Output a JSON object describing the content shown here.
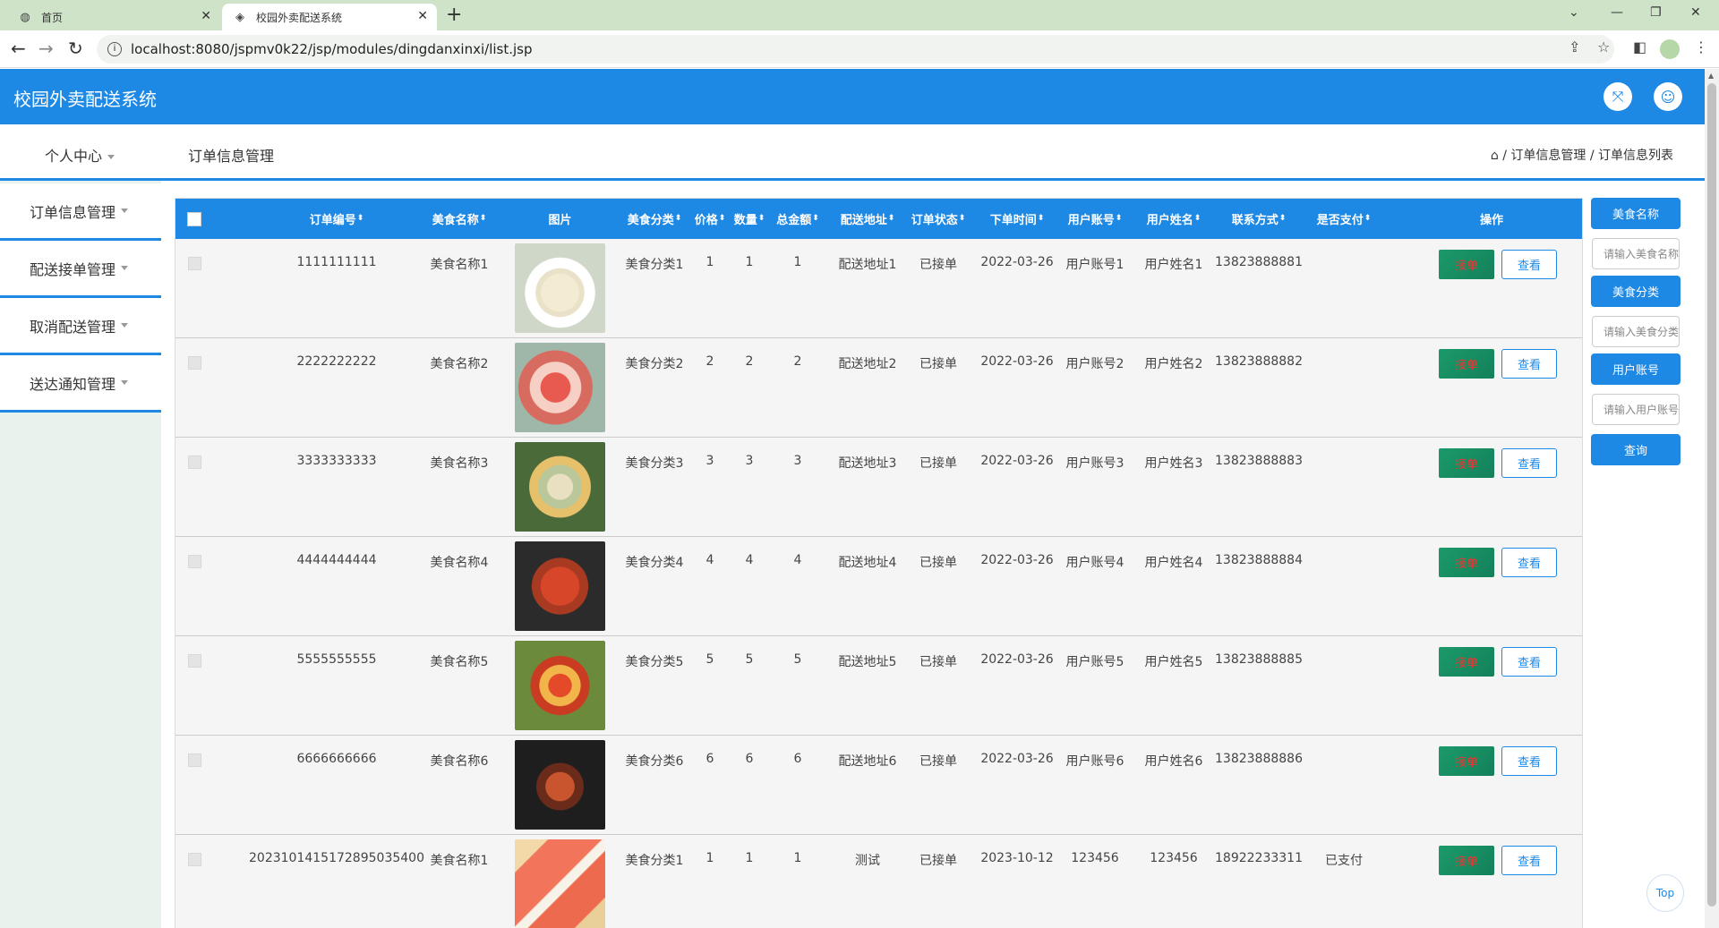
{
  "browser": {
    "tabs": [
      {
        "title": "首页"
      },
      {
        "title": "校园外卖配送系统"
      }
    ],
    "url": "localhost:8080/jspmv0k22/jsp/modules/dingdanxinxi/list.jsp"
  },
  "app": {
    "title": "校园外卖配送系统"
  },
  "sidebar": {
    "top": "个人中心",
    "items": [
      {
        "label": "订单信息管理"
      },
      {
        "label": "配送接单管理"
      },
      {
        "label": "取消配送管理"
      },
      {
        "label": "送达通知管理"
      }
    ]
  },
  "breadcrumb": {
    "title": "订单信息管理",
    "path": "/ 订单信息管理 / 订单信息列表"
  },
  "table": {
    "headers": [
      "订单编号",
      "美食名称",
      "图片",
      "美食分类",
      "价格",
      "数量",
      "总金额",
      "配送地址",
      "订单状态",
      "下单时间",
      "用户账号",
      "用户姓名",
      "联系方式",
      "是否支付",
      "操作"
    ],
    "rows": [
      {
        "order_no": "1111111111",
        "food": "美食名称1",
        "category": "美食分类1",
        "price": "1",
        "qty": "1",
        "total": "1",
        "address": "配送地址1",
        "status": "已接单",
        "time": "2022-03-26",
        "account": "用户账号1",
        "name": "用户姓名1",
        "phone": "13823888881",
        "paid": "",
        "img": "soup"
      },
      {
        "order_no": "2222222222",
        "food": "美食名称2",
        "category": "美食分类2",
        "price": "2",
        "qty": "2",
        "total": "2",
        "address": "配送地址2",
        "status": "已接单",
        "time": "2022-03-26",
        "account": "用户账号2",
        "name": "用户姓名2",
        "phone": "13823888882",
        "paid": "",
        "img": "dessert"
      },
      {
        "order_no": "3333333333",
        "food": "美食名称3",
        "category": "美食分类3",
        "price": "3",
        "qty": "3",
        "total": "3",
        "address": "配送地址3",
        "status": "已接单",
        "time": "2022-03-26",
        "account": "用户账号3",
        "name": "用户姓名3",
        "phone": "13823888883",
        "paid": "",
        "img": "stew"
      },
      {
        "order_no": "4444444444",
        "food": "美食名称4",
        "category": "美食分类4",
        "price": "4",
        "qty": "4",
        "total": "4",
        "address": "配送地址4",
        "status": "已接单",
        "time": "2022-03-26",
        "account": "用户账号4",
        "name": "用户姓名4",
        "phone": "13823888884",
        "paid": "",
        "img": "shrimp"
      },
      {
        "order_no": "5555555555",
        "food": "美食名称5",
        "category": "美食分类5",
        "price": "5",
        "qty": "5",
        "total": "5",
        "address": "配送地址5",
        "status": "已接单",
        "time": "2022-03-26",
        "account": "用户账号5",
        "name": "用户姓名5",
        "phone": "13823888885",
        "paid": "",
        "img": "pizza"
      },
      {
        "order_no": "6666666666",
        "food": "美食名称6",
        "category": "美食分类6",
        "price": "6",
        "qty": "6",
        "total": "6",
        "address": "配送地址6",
        "status": "已接单",
        "time": "2022-03-26",
        "account": "用户账号6",
        "name": "用户姓名6",
        "phone": "13823888886",
        "paid": "",
        "img": "grill"
      },
      {
        "order_no": "2023101415172895035400",
        "food": "美食名称1",
        "category": "美食分类1",
        "price": "1",
        "qty": "1",
        "total": "1",
        "address": "测试",
        "status": "已接单",
        "time": "2023-10-12",
        "account": "123456",
        "name": "123456",
        "phone": "18922233311",
        "paid": "已支付",
        "img": "sashimi"
      }
    ],
    "take_label": "接单",
    "view_label": "查看"
  },
  "search": {
    "food_label": "美食名称",
    "food_placeholder": "请输入美食名称",
    "category_label": "美食分类",
    "category_placeholder": "请输入美食分类",
    "account_label": "用户账号",
    "account_placeholder": "请输入用户账号",
    "query_label": "查询"
  },
  "top_button": "Top",
  "colors": {
    "primary": "#1e88e5",
    "take_button": "#1b9a6a",
    "sidebar_bg": "#e8f3ee"
  }
}
